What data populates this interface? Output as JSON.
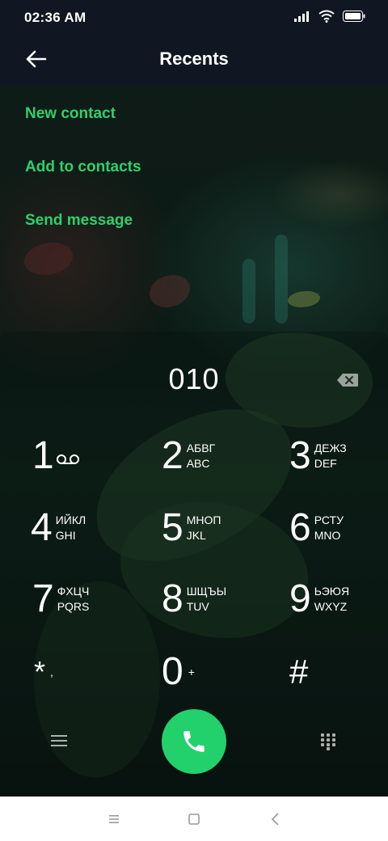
{
  "status_bar": {
    "time": "02:36 AM",
    "icons": [
      "signal-icon",
      "wifi-icon",
      "battery-icon"
    ]
  },
  "app_bar": {
    "title": "Recents",
    "back_icon": "arrow-left-icon"
  },
  "menu": {
    "items": [
      {
        "label": "New contact"
      },
      {
        "label": "Add to contacts"
      },
      {
        "label": "Send message"
      }
    ]
  },
  "dialer": {
    "number": "010",
    "backspace_icon": "backspace-icon",
    "keys": [
      {
        "digit": "1",
        "cyrillic": "",
        "latin": "",
        "voicemail_icon": "voicemail-icon"
      },
      {
        "digit": "2",
        "cyrillic": "АБВГ",
        "latin": "ABC"
      },
      {
        "digit": "3",
        "cyrillic": "ДЕЖЗ",
        "latin": "DEF"
      },
      {
        "digit": "4",
        "cyrillic": "ИЙКЛ",
        "latin": "GHI"
      },
      {
        "digit": "5",
        "cyrillic": "МНОП",
        "latin": "JKL"
      },
      {
        "digit": "6",
        "cyrillic": "РСТУ",
        "latin": "MNO"
      },
      {
        "digit": "7",
        "cyrillic": "ФХЦЧ",
        "latin": "PQRS"
      },
      {
        "digit": "8",
        "cyrillic": "ШЩЪЫ",
        "latin": "TUV"
      },
      {
        "digit": "9",
        "cyrillic": "ЬЭЮЯ",
        "latin": "WXYZ"
      },
      {
        "digit": "*",
        "extra": ","
      },
      {
        "digit": "0",
        "extra": "+"
      },
      {
        "digit": "#",
        "extra": ""
      }
    ]
  },
  "actions": {
    "menu_icon": "hamburger-icon",
    "call_icon": "phone-icon",
    "keypad_icon": "keypad-grid-icon",
    "call_color": "#22d16b"
  },
  "nav_bar": {
    "icons": [
      "recents-icon",
      "home-icon",
      "back-icon"
    ]
  },
  "colors": {
    "accent": "#2fd06d",
    "header_bg": "#101722"
  }
}
